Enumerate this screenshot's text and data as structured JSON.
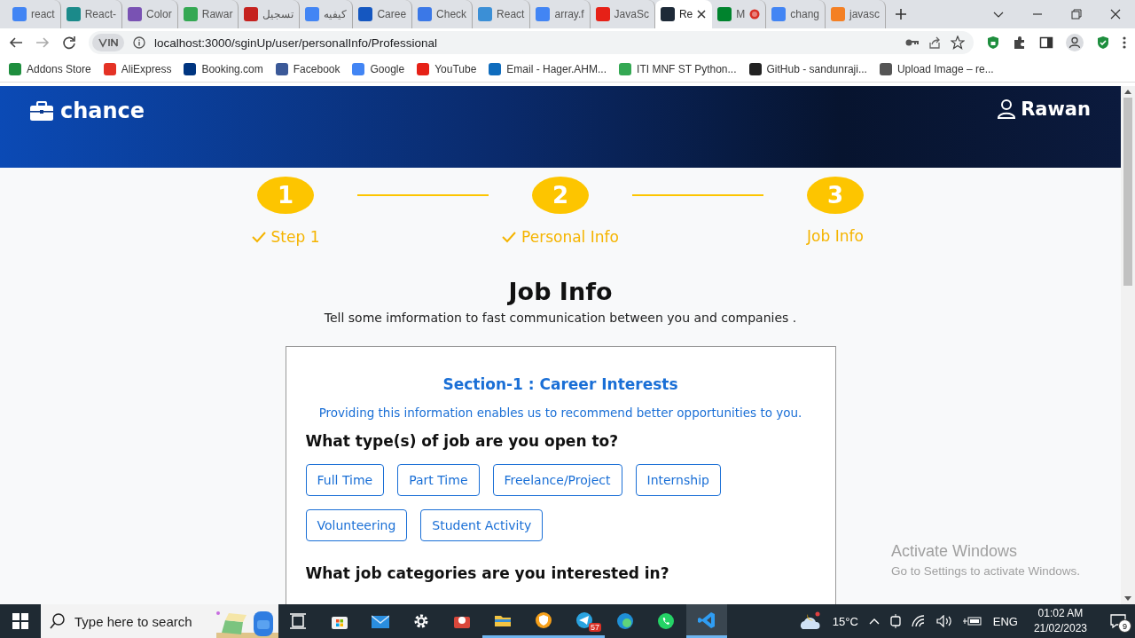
{
  "browser": {
    "tabs": [
      {
        "title": "react",
        "selected": false,
        "color": "#4285f4",
        "recording": false
      },
      {
        "title": "React-",
        "selected": false,
        "color": "#1b8a8a",
        "recording": false
      },
      {
        "title": "Color",
        "selected": false,
        "color": "#7952b3",
        "recording": false
      },
      {
        "title": "Rawar",
        "selected": false,
        "color": "#34a853",
        "recording": false
      },
      {
        "title": "تسجيل",
        "selected": false,
        "color": "#c5221f",
        "recording": false
      },
      {
        "title": "كيفيه",
        "selected": false,
        "color": "#4285f4",
        "recording": false
      },
      {
        "title": "Caree",
        "selected": false,
        "color": "#1557c0",
        "recording": false
      },
      {
        "title": "Check",
        "selected": false,
        "color": "#3b78e7",
        "recording": false
      },
      {
        "title": "React",
        "selected": false,
        "color": "#3b8fd6",
        "recording": false
      },
      {
        "title": "array.f",
        "selected": false,
        "color": "#4285f4",
        "recording": false
      },
      {
        "title": "JavaSc",
        "selected": false,
        "color": "#e62117",
        "recording": false
      },
      {
        "title": "Re",
        "selected": true,
        "color": "#1e2a38",
        "recording": false
      },
      {
        "title": "M",
        "selected": false,
        "color": "#00832d",
        "recording": true
      },
      {
        "title": "chang",
        "selected": false,
        "color": "#4285f4",
        "recording": false
      },
      {
        "title": "javasc",
        "selected": false,
        "color": "#f48024",
        "recording": false
      }
    ],
    "url": "localhost:3000/sginUp/user/personalInfo/Professional",
    "bookmarks": [
      {
        "label": "Addons Store",
        "color": "#1e8e3e"
      },
      {
        "label": "AliExpress",
        "color": "#e43225"
      },
      {
        "label": "Booking.com",
        "color": "#003580"
      },
      {
        "label": "Facebook",
        "color": "#3b5998"
      },
      {
        "label": "Google",
        "color": "#4285f4"
      },
      {
        "label": "YouTube",
        "color": "#e62117"
      },
      {
        "label": "Email - Hager.AHM...",
        "color": "#0f6cbd"
      },
      {
        "label": "ITI MNF ST Python...",
        "color": "#34a853"
      },
      {
        "label": "GitHub - sandunraji...",
        "color": "#222222"
      },
      {
        "label": "Upload Image – re...",
        "color": "#555555"
      }
    ]
  },
  "header": {
    "brand": "chance",
    "user": "Rawan"
  },
  "steps": [
    {
      "number": "1",
      "label": "Step 1",
      "done": true
    },
    {
      "number": "2",
      "label": "Personal Info",
      "done": true
    },
    {
      "number": "3",
      "label": "Job Info",
      "done": false
    }
  ],
  "page": {
    "title": "Job Info",
    "subtitle": "Tell some imformation to fast communication between you and companies ."
  },
  "section": {
    "heading": "Section-1 : Career Interests",
    "description": "Providing this information enables us to recommend better opportunities to you.",
    "questions": [
      {
        "text": "What type(s) of job are you open to?",
        "options": [
          {
            "label": "Full Time",
            "selected": false
          },
          {
            "label": "Part Time",
            "selected": false
          },
          {
            "label": "Freelance/Project",
            "selected": false
          },
          {
            "label": "Internship",
            "selected": false
          },
          {
            "label": "Volunteering",
            "selected": false
          },
          {
            "label": "Student Activity",
            "selected": false
          }
        ]
      },
      {
        "text": "What job categories are you interested in?"
      }
    ]
  },
  "activation": {
    "title": "Activate Windows",
    "hint": "Go to Settings to activate Windows."
  },
  "taskbar": {
    "search": {
      "placeholder": "Type here to search"
    },
    "telegram_badge": "57",
    "temperature": "15°C",
    "language": "ENG",
    "time": "01:02 AM",
    "date": "21/02/2023",
    "notifications": "9"
  }
}
